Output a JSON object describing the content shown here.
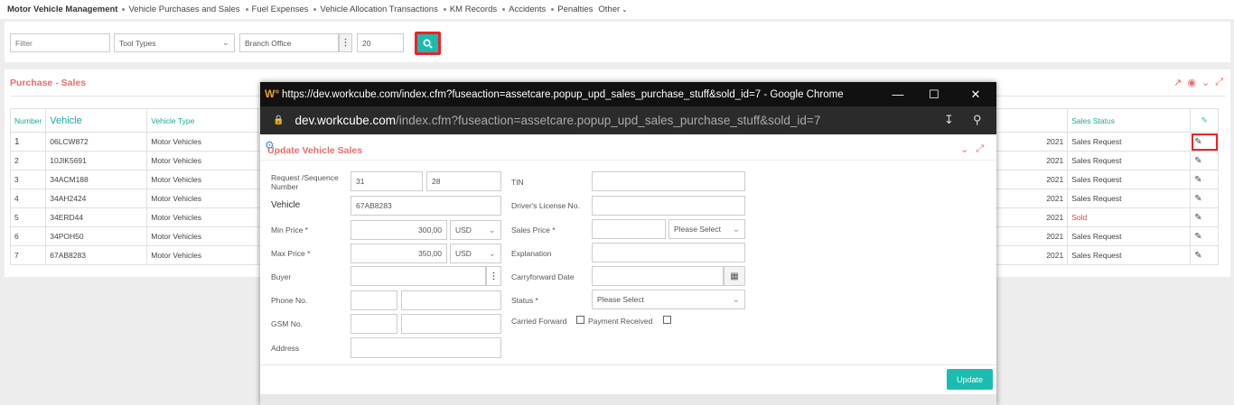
{
  "topnav": {
    "brand": "Motor Vehicle Management",
    "items": [
      "Vehicle Purchases and Sales",
      "Fuel Expenses",
      "Vehicle Allocation Transactions",
      "KM Records",
      "Accidents",
      "Penalties"
    ],
    "other": "Other"
  },
  "filters": {
    "filter_placeholder": "Filter",
    "tool_types": "Tool Types",
    "branch_office": "Branch Office",
    "page_size": "20"
  },
  "panel": {
    "title": "Purchase - Sales",
    "columns": {
      "number": "Number",
      "vehicle": "Vehicle",
      "vehicle_type": "Vehicle Type",
      "sales_status": "Sales Status"
    },
    "rows": [
      {
        "num": "1",
        "vehicle": "06LCW872",
        "type": "Motor Vehicles",
        "year": "2021",
        "status": "Sales Request"
      },
      {
        "num": "2",
        "vehicle": "10JIK5691",
        "type": "Motor Vehicles",
        "year": "2021",
        "status": "Sales Request"
      },
      {
        "num": "3",
        "vehicle": "34ACM188",
        "type": "Motor Vehicles",
        "year": "2021",
        "status": "Sales Request"
      },
      {
        "num": "4",
        "vehicle": "34AH2424",
        "type": "Motor Vehicles",
        "year": "2021",
        "status": "Sales Request"
      },
      {
        "num": "5",
        "vehicle": "34ERD44",
        "type": "Motor Vehicles",
        "year": "2021",
        "status": "Sold"
      },
      {
        "num": "6",
        "vehicle": "34POH50",
        "type": "Motor Vehicles",
        "year": "2021",
        "status": "Sales Request"
      },
      {
        "num": "7",
        "vehicle": "67AB8283",
        "type": "Motor Vehicles",
        "year": "2021",
        "status": "Sales Request"
      }
    ]
  },
  "popup": {
    "window_title": "https://dev.workcube.com/index.cfm?fuseaction=assetcare.popup_upd_sales_purchase_stuff&sold_id=7 - Google Chrome",
    "url_domain": "dev.workcube.com",
    "url_path": "/index.cfm?fuseaction=assetcare.popup_upd_sales_purchase_stuff&sold_id=7",
    "form_title": "Update Vehicle Sales",
    "labels": {
      "request_seq": "Request /Sequence Number",
      "vehicle": "Vehicle",
      "min_price": "Min Price *",
      "max_price": "Max Price *",
      "buyer": "Buyer",
      "phone": "Phone No.",
      "gsm": "GSM No.",
      "address": "Address",
      "tin": "TIN",
      "license": "Driver's License No.",
      "sales_price": "Sales Price *",
      "explanation": "Explanation",
      "carry_date": "Carryforward Date",
      "status": "Status *",
      "carried_forward": "Carried Forward",
      "payment_received": "Payment Received"
    },
    "values": {
      "request": "31",
      "sequence": "28",
      "vehicle": "67AB8283",
      "min_price": "300,00",
      "min_currency": "USD",
      "max_price": "350,00",
      "max_currency": "USD",
      "sales_currency": "Please Select",
      "status": "Please Select"
    },
    "update_label": "Update"
  },
  "colors": {
    "accent": "#1bbcb0",
    "title_red": "#e46e6e",
    "sold_red": "#e03c3c",
    "highlight": "#e22222"
  }
}
